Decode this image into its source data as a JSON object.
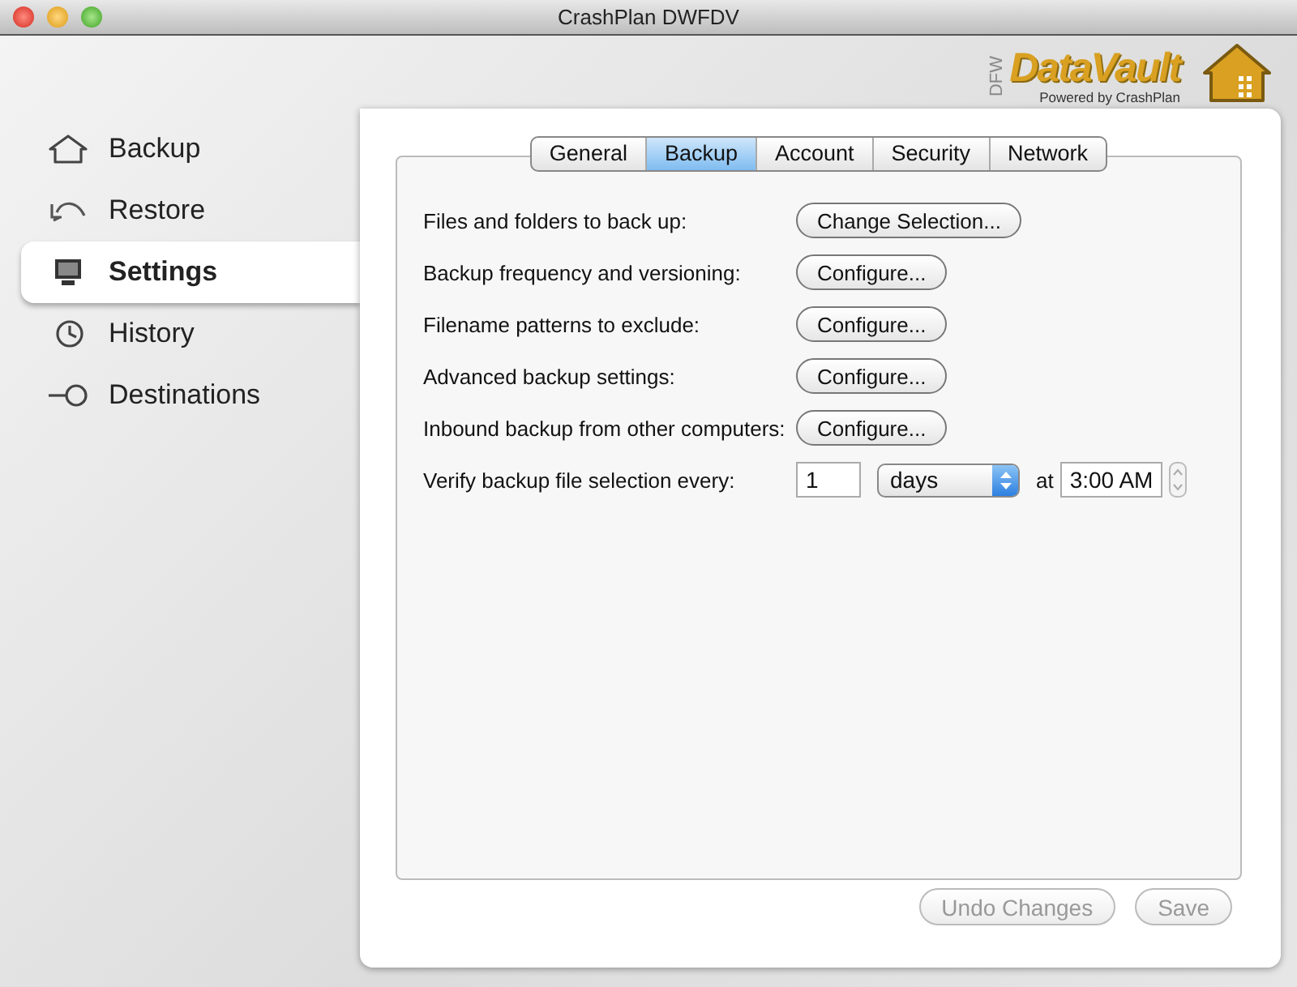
{
  "window": {
    "title": "CrashPlan DWFDV"
  },
  "logo": {
    "side_text": "DFW",
    "name": "DataVault",
    "tagline": "Powered by CrashPlan"
  },
  "sidebar": {
    "items": [
      {
        "label": "Backup",
        "selected": false
      },
      {
        "label": "Restore",
        "selected": false
      },
      {
        "label": "Settings",
        "selected": true
      },
      {
        "label": "History",
        "selected": false
      },
      {
        "label": "Destinations",
        "selected": false
      }
    ]
  },
  "tabs": [
    {
      "label": "General",
      "selected": false
    },
    {
      "label": "Backup",
      "selected": true
    },
    {
      "label": "Account",
      "selected": false
    },
    {
      "label": "Security",
      "selected": false
    },
    {
      "label": "Network",
      "selected": false
    }
  ],
  "settings": [
    {
      "kind": "button",
      "label": "Files and folders to back up:",
      "button": "Change Selection..."
    },
    {
      "kind": "button",
      "label": "Backup frequency and versioning:",
      "button": "Configure..."
    },
    {
      "kind": "button",
      "label": "Filename patterns to exclude:",
      "button": "Configure..."
    },
    {
      "kind": "button",
      "label": "Advanced backup settings:",
      "button": "Configure..."
    },
    {
      "kind": "button",
      "label": "Inbound backup from other computers:",
      "button": "Configure..."
    },
    {
      "kind": "schedule",
      "label": "Verify backup file selection every:",
      "count": "1",
      "unit": "days",
      "at": "at",
      "time": "3:00 AM"
    }
  ],
  "footer_buttons": [
    {
      "label": "Undo Changes",
      "disabled": true
    },
    {
      "label": "Save",
      "disabled": true
    }
  ]
}
